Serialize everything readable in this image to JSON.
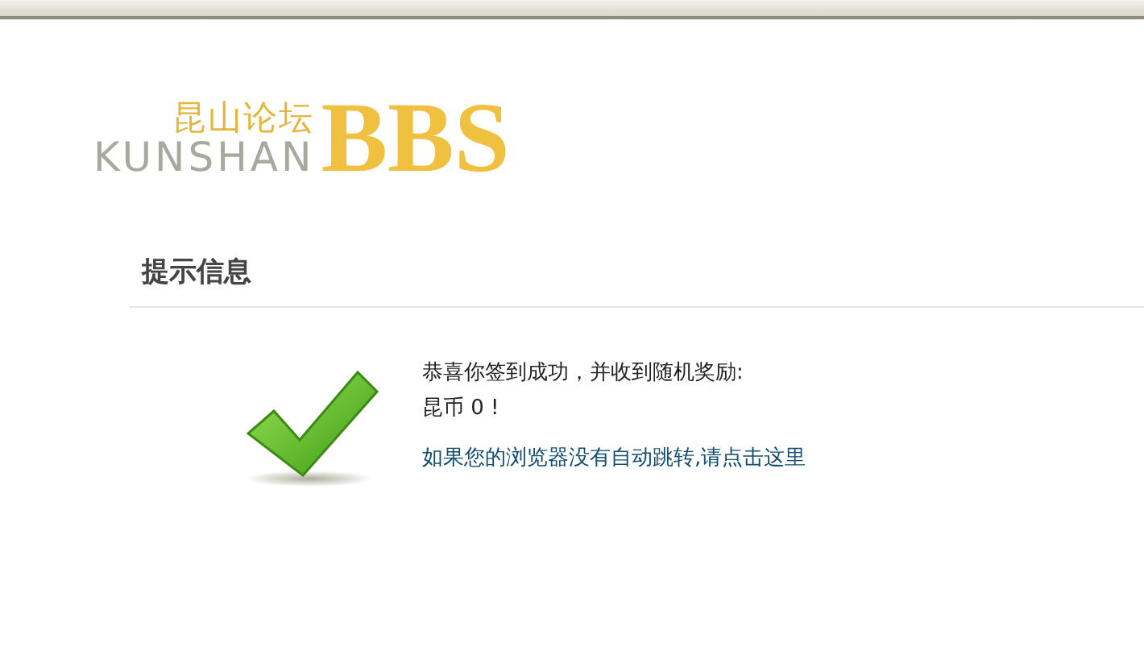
{
  "logo": {
    "chinese": "昆山论坛",
    "latin": "KUNSHAN",
    "bbs": "BBS"
  },
  "notice": {
    "title": "提示信息",
    "message": "恭喜你签到成功，并收到随机奖励:",
    "reward": "昆币 0 !",
    "link": "如果您的浏览器没有自动跳转,请点击这里"
  }
}
